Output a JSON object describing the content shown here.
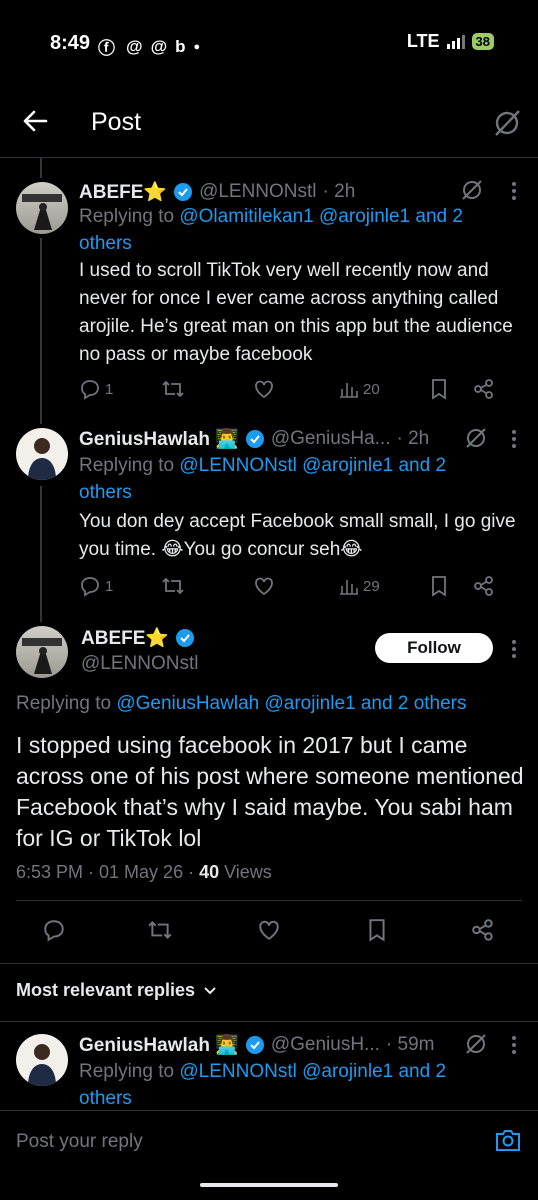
{
  "status_bar": {
    "time": "8:49",
    "network": "LTE",
    "battery": "38"
  },
  "header": {
    "title": "Post"
  },
  "reply1": {
    "name": "ABEFE⭐",
    "handle": "@LENNONstl",
    "time": "· 2h",
    "replying_prefix": "Replying to ",
    "replying_to": "@Olamitilekan1 @arojinle1 and 2 others",
    "text": "I used to scroll TikTok very well recently now and never for once I ever came across anything called arojile. He’s great man on this app but the audience no pass or maybe facebook",
    "replies": "1",
    "views": "20"
  },
  "reply2": {
    "name": "GeniusHawlah 👨‍💻",
    "handle": "@GeniusHa...",
    "time": "· 2h",
    "replying_prefix": "Replying to ",
    "replying_to": "@LENNONstl @arojinle1 and 2 others",
    "text": "You don dey accept Facebook small small, I go give you time. 😂You go concur seh😂",
    "replies": "1",
    "views": "29"
  },
  "main_post": {
    "name": "ABEFE⭐",
    "handle": "@LENNONstl",
    "follow_label": "Follow",
    "replying_prefix": "Replying to ",
    "replying_to": "@GeniusHawlah @arojinle1 and 2 others",
    "text": "I stopped using facebook in 2017 but I came across one of his post where someone mentioned Facebook that’s why I said maybe. You sabi ham for IG or TikTok lol",
    "timestamp": "6:53 PM · 01 May 26 · ",
    "views_count": "40",
    "views_label": " Views"
  },
  "sort": {
    "label": "Most relevant replies"
  },
  "reply3": {
    "name": "GeniusHawlah 👨‍💻",
    "handle": "@GeniusH...",
    "time": "· 59m",
    "replying_prefix": "Replying to ",
    "replying_to": "@LENNONstl @arojinle1 and 2 others"
  },
  "composer": {
    "placeholder": "Post your reply"
  },
  "colors": {
    "background": "#000000",
    "accent": "#1d9bf0",
    "muted": "#71767b",
    "verified": "#1d9bf0",
    "battery": "#9ccc65"
  },
  "icons": {
    "back": "arrow-left-icon",
    "grok": "grok-icon",
    "more": "more-vertical-icon",
    "reply": "comment-icon",
    "repost": "repost-icon",
    "like": "heart-icon",
    "views": "bar-chart-icon",
    "bookmark": "bookmark-icon",
    "share": "share-icon",
    "camera": "camera-icon"
  }
}
